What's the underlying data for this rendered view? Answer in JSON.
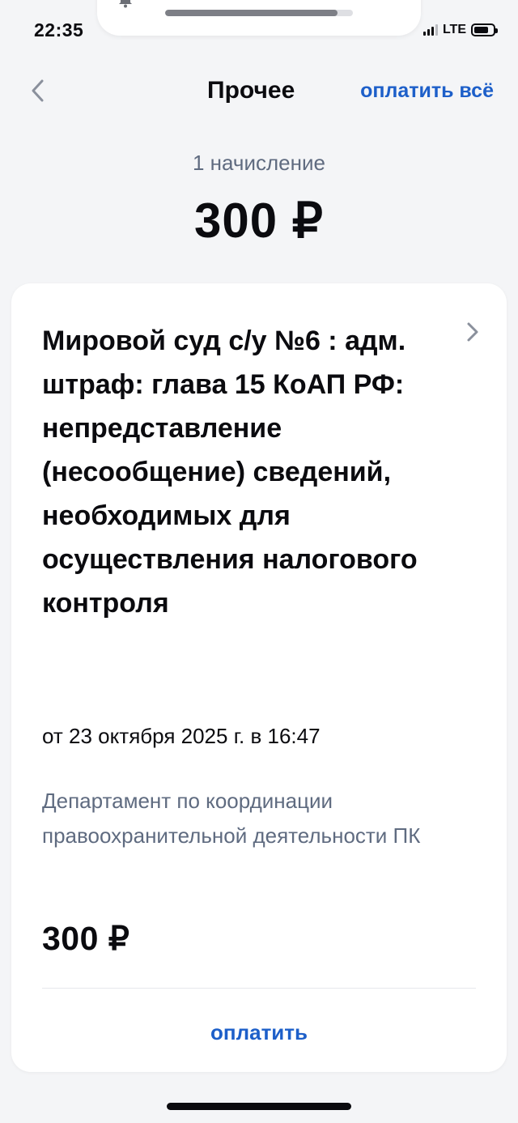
{
  "status_bar": {
    "time": "22:35",
    "network": "LTE",
    "battery_level": 0.75,
    "notification_progress": 0.92,
    "icons": [
      "bell-icon",
      "signal-icon",
      "battery-icon"
    ]
  },
  "nav": {
    "back_icon": "chevron-left-icon",
    "title": "Прочее",
    "pay_all_label": "оплатить всё"
  },
  "summary": {
    "charges_count": "1 начисление",
    "total": "300 ₽"
  },
  "charge": {
    "title": "Мировой суд с/у №6 : адм. штраф: глава 15 КоАП РФ: непредставление (несообщение) сведений, необходимых для осуществления налогового контроля",
    "date": "от 23 октября 2025 г. в 16:47",
    "department": "Департамент по координации правоохранительной деятельности ПК",
    "amount": "300 ₽",
    "pay_label": "оплатить",
    "chevron_icon": "chevron-right-icon"
  },
  "colors": {
    "accent": "#1d5fc9",
    "secondary_text": "#5f6b80",
    "background": "#f4f5f7",
    "card": "#ffffff"
  }
}
